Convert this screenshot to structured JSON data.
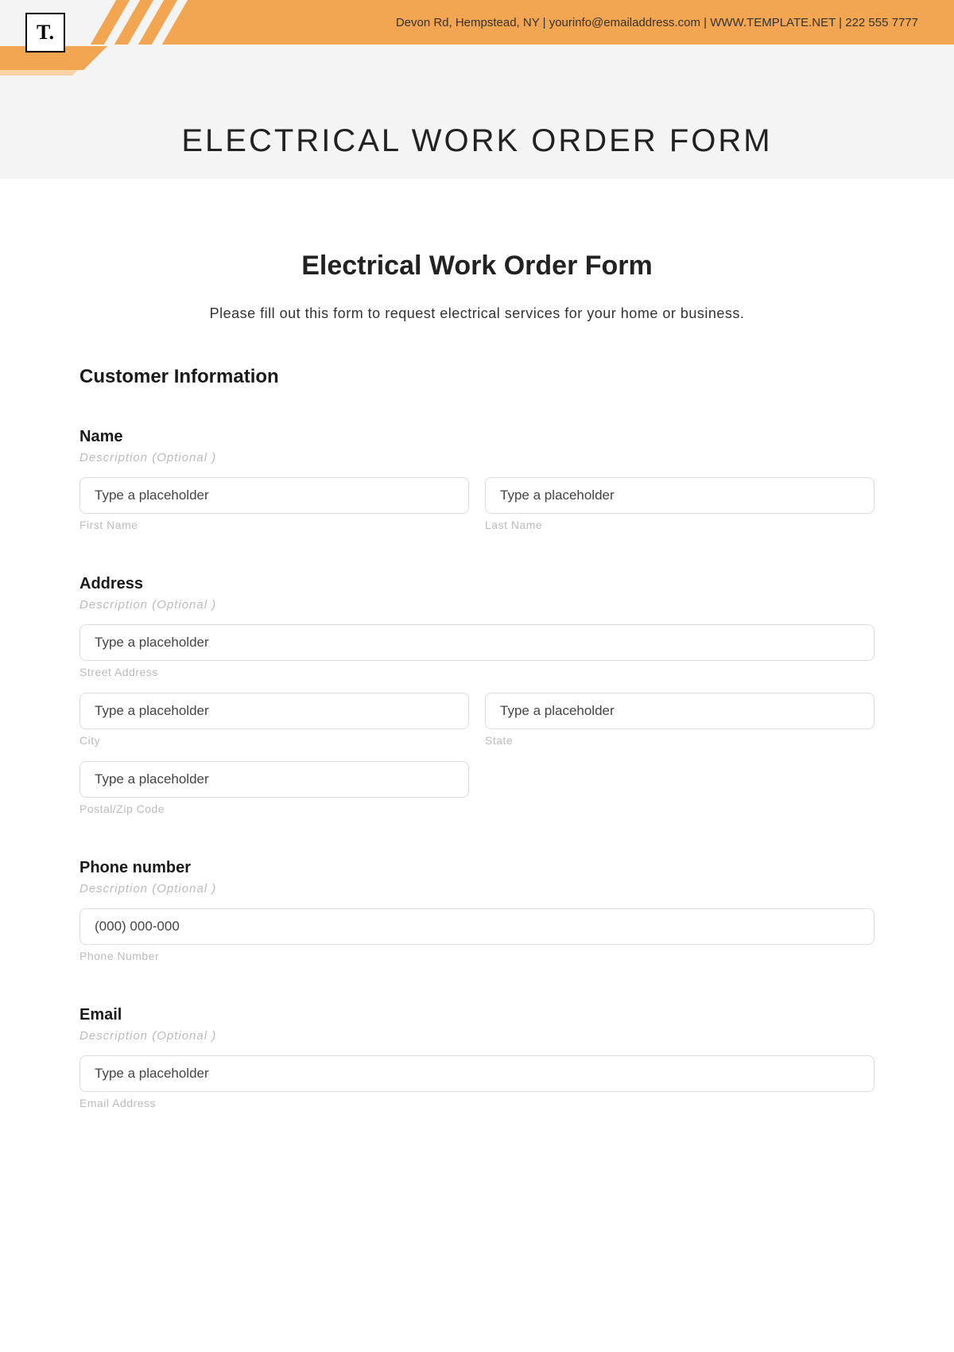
{
  "header": {
    "logo": "T.",
    "contact_text": "Devon Rd, Hempstead, NY | yourinfo@emailaddress.com | WWW.TEMPLATE.NET | 222 555 7777"
  },
  "page_title": "ELECTRICAL WORK ORDER FORM",
  "form": {
    "title": "Electrical Work Order Form",
    "intro": "Please fill out this form to request electrical services for your home or business.",
    "section_heading": "Customer Information",
    "desc_optional": "Description (Optional )",
    "placeholder": "Type a placeholder",
    "phone_placeholder": "(000) 000-000",
    "fields": {
      "name": {
        "label": "Name",
        "first": "First Name",
        "last": "Last Name"
      },
      "address": {
        "label": "Address",
        "street": "Street Address",
        "city": "City",
        "state": "State",
        "postal": "Postal/Zip Code"
      },
      "phone": {
        "label": "Phone number",
        "sub": "Phone Number"
      },
      "email": {
        "label": "Email",
        "sub": "Email Address"
      }
    }
  }
}
